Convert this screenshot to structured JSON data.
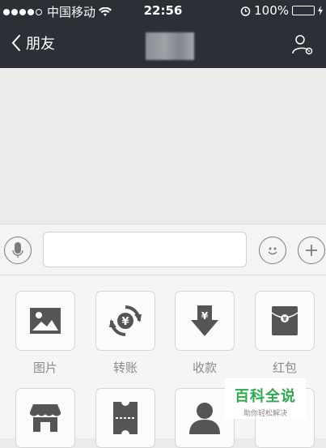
{
  "status_bar": {
    "carrier": "中国移动",
    "time": "22:56",
    "battery": "100%"
  },
  "nav": {
    "back_label": "朋友"
  },
  "input": {
    "placeholder": ""
  },
  "tools_row1": [
    {
      "label": "图片",
      "icon": "image-icon"
    },
    {
      "label": "转账",
      "icon": "transfer-icon"
    },
    {
      "label": "收款",
      "icon": "receive-money-icon"
    },
    {
      "label": "红包",
      "icon": "red-packet-icon"
    }
  ],
  "tools_row2": [
    {
      "label": "",
      "icon": "store-icon"
    },
    {
      "label": "",
      "icon": "coupon-icon"
    },
    {
      "label": "",
      "icon": "contact-card-icon"
    }
  ],
  "watermark": {
    "title": "百科全说",
    "subtitle": "助你轻松解决"
  },
  "colors": {
    "header_bg": "#2b3037",
    "battery_green": "#4cd964",
    "watermark_green": "#2fa84f"
  }
}
